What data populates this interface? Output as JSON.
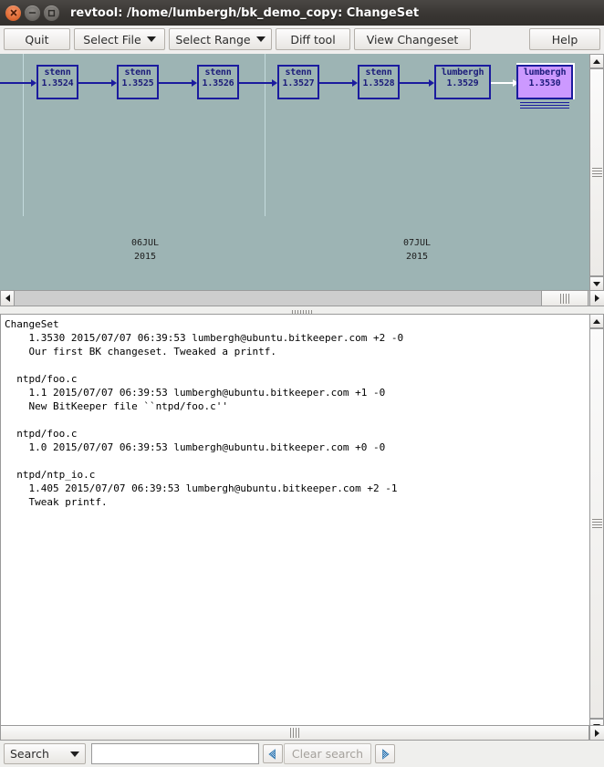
{
  "window": {
    "title": "revtool: /home/lumbergh/bk_demo_copy: ChangeSet",
    "close_icon": "close-icon",
    "minimize_icon": "minimize-icon",
    "maximize_icon": "maximize-icon"
  },
  "toolbar": {
    "quit_label": "Quit",
    "select_file_label": "Select File",
    "select_range_label": "Select Range",
    "diff_tool_label": "Diff tool",
    "view_changeset_label": "View Changeset",
    "help_label": "Help"
  },
  "graph": {
    "background_color": "#9db4b4",
    "node_border_color": "#1b1b9e",
    "selected_fill_color": "#cc99ff",
    "nodes": [
      {
        "user": "stenn",
        "rev": "1.3524",
        "selected": false
      },
      {
        "user": "stenn",
        "rev": "1.3525",
        "selected": false
      },
      {
        "user": "stenn",
        "rev": "1.3526",
        "selected": false
      },
      {
        "user": "stenn",
        "rev": "1.3527",
        "selected": false
      },
      {
        "user": "stenn",
        "rev": "1.3528",
        "selected": false
      },
      {
        "user": "lumbergh",
        "rev": "1.3529",
        "selected": false
      },
      {
        "user": "lumbergh",
        "rev": "1.3530",
        "selected": true
      }
    ],
    "day_labels": [
      {
        "day": "06JUL",
        "year": "2015"
      },
      {
        "day": "07JUL",
        "year": "2015"
      }
    ]
  },
  "changeset_text": "ChangeSet\n    1.3530 2015/07/07 06:39:53 lumbergh@ubuntu.bitkeeper.com +2 -0\n    Our first BK changeset. Tweaked a printf.\n\n  ntpd/foo.c\n    1.1 2015/07/07 06:39:53 lumbergh@ubuntu.bitkeeper.com +1 -0\n    New BitKeeper file ``ntpd/foo.c''\n\n  ntpd/foo.c\n    1.0 2015/07/07 06:39:53 lumbergh@ubuntu.bitkeeper.com +0 -0\n\n  ntpd/ntp_io.c\n    1.405 2015/07/07 06:39:53 lumbergh@ubuntu.bitkeeper.com +2 -1\n    Tweak printf.",
  "search": {
    "mode_label": "Search",
    "input_value": "",
    "input_placeholder": "",
    "prev_icon": "arrow-left-icon",
    "next_icon": "arrow-right-icon",
    "clear_label": "Clear search"
  },
  "scrollbars": {
    "up_icon": "scroll-up-icon",
    "down_icon": "scroll-down-icon",
    "left_icon": "scroll-left-icon",
    "right_icon": "scroll-right-icon"
  }
}
